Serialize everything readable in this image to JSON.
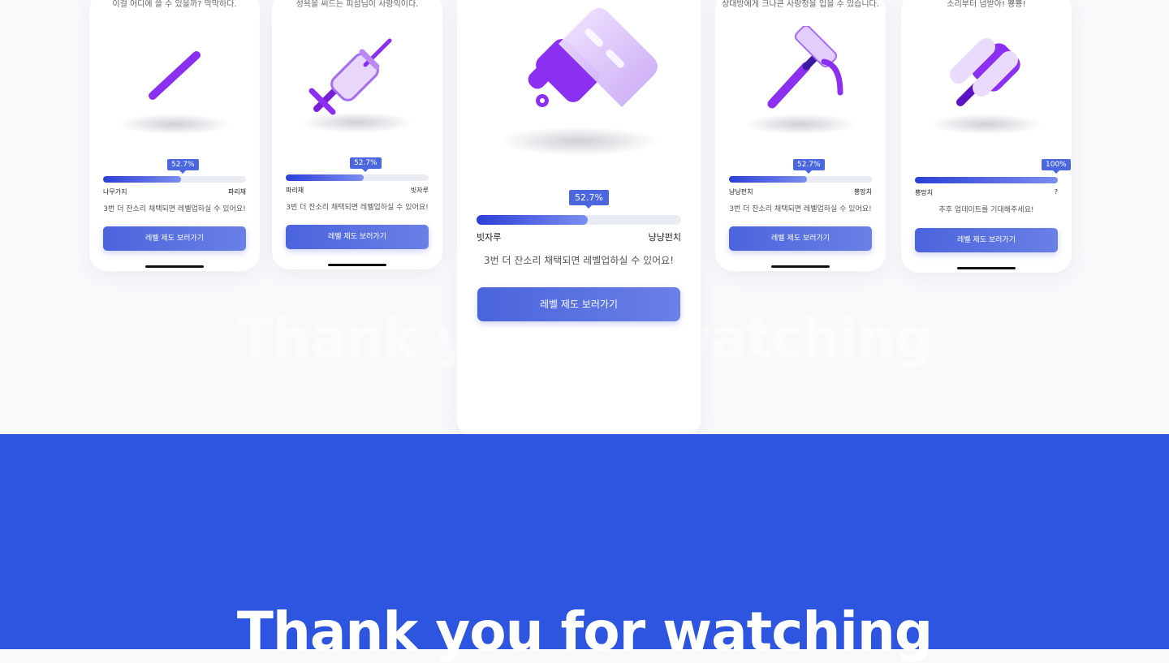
{
  "hero_text": "Thank you for watching",
  "ghost_text": "Thank you for watching",
  "colors": {
    "accent": "#2d55e0",
    "purple": "#8b2ff0",
    "button": "#5a72e2"
  },
  "phones": [
    {
      "caption": "이걸 어디에 쓸 수 있을까? 막막하다.",
      "tooltip": "52.7%",
      "progress": 0.527,
      "left_label": "나무가지",
      "right_label": "파리채",
      "message": "3번 더 잔소리 채택되면 레벨업하실 수 있어요!",
      "button": "레벨 제도 보러가기",
      "icon": "stick-icon"
    },
    {
      "caption": "성욕을 씨드는 피섬님이 사랑익이다.",
      "tooltip": "52.7%",
      "progress": 0.527,
      "left_label": "파리채",
      "right_label": "빗자루",
      "message": "3번 더 잔소리 채택되면 레벨업하실 수 있어요!",
      "button": "레벨 제도 보러가기",
      "icon": "syringe-icon"
    },
    {
      "caption": "",
      "tooltip": "52.7%",
      "progress": 0.527,
      "left_label": "빗자루",
      "right_label": "냥냥펀치",
      "message": "3번 더 잔소리 채택되면 레벨업하실 수 있어요!",
      "button": "레벨 제도 보러가기",
      "icon": "paint-scraper-icon"
    },
    {
      "caption": "상대방에게 크나큰 사랑정을 입을 수 있습니다.",
      "tooltip": "52.7%",
      "progress": 0.527,
      "left_label": "냥냥펀치",
      "right_label": "뿅망치",
      "message": "3번 더 잔소리 채택되면 레벨업하실 수 있어요!",
      "button": "레벨 제도 보러가기",
      "icon": "hammer-icon"
    },
    {
      "caption": "소리부터 넘받아! 뿅뿅!",
      "tooltip": "100%",
      "progress": 1.0,
      "left_label": "뿅망치",
      "right_label": "?",
      "message": "추후 업데이트를 기대해주세요!",
      "button": "레벨 제도 보러가기",
      "icon": "mallet-icon"
    }
  ]
}
